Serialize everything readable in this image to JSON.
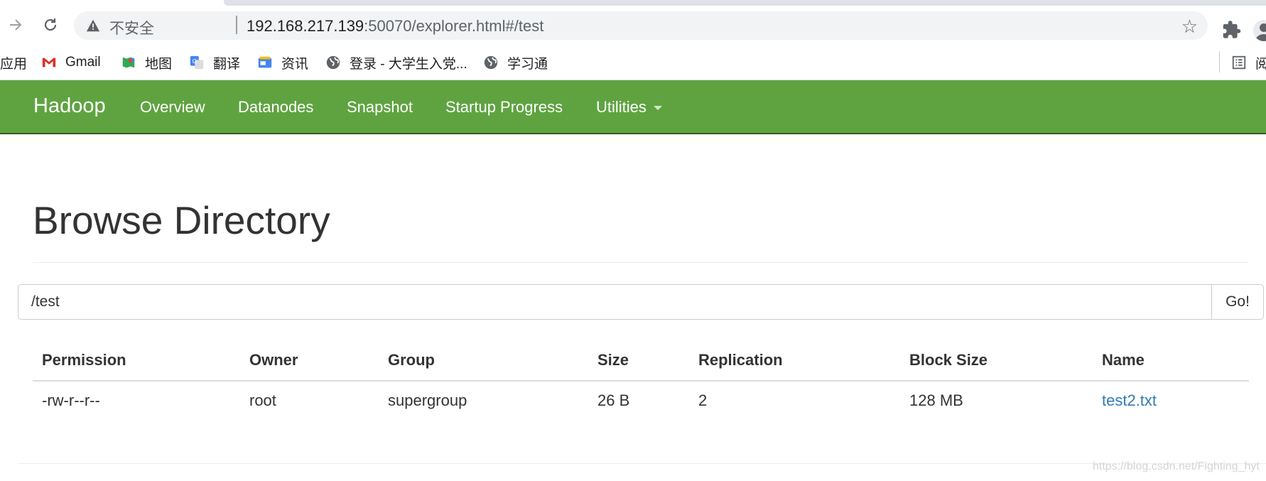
{
  "browser": {
    "insecure_label": "不安全",
    "url_host": "192.168.217.139",
    "url_rest": ":50070/explorer.html#/test"
  },
  "bookmarks": [
    {
      "label": "应用",
      "icon": "apps-icon"
    },
    {
      "label": "Gmail",
      "icon": "gmail-icon"
    },
    {
      "label": "地图",
      "icon": "maps-icon"
    },
    {
      "label": "翻译",
      "icon": "translate-icon"
    },
    {
      "label": "资讯",
      "icon": "news-icon"
    },
    {
      "label": "登录 - 大学生入党...",
      "icon": "globe-icon"
    },
    {
      "label": "学习通",
      "icon": "globe-icon"
    }
  ],
  "reading_list_label": "阅",
  "navbar": {
    "brand": "Hadoop",
    "items": [
      "Overview",
      "Datanodes",
      "Snapshot",
      "Startup Progress",
      "Utilities"
    ]
  },
  "main": {
    "title": "Browse Directory",
    "path_value": "/test",
    "go_label": "Go!"
  },
  "table": {
    "headers": [
      "Permission",
      "Owner",
      "Group",
      "Size",
      "Replication",
      "Block Size",
      "Name"
    ],
    "rows": [
      [
        "-rw-r--r--",
        "root",
        "supergroup",
        "26 B",
        "2",
        "128 MB",
        "test2.txt"
      ]
    ]
  },
  "watermark": "https://blog.csdn.net/Fighting_hyt",
  "colors": {
    "navbar": "#5fa341",
    "link": "#337ab7"
  }
}
